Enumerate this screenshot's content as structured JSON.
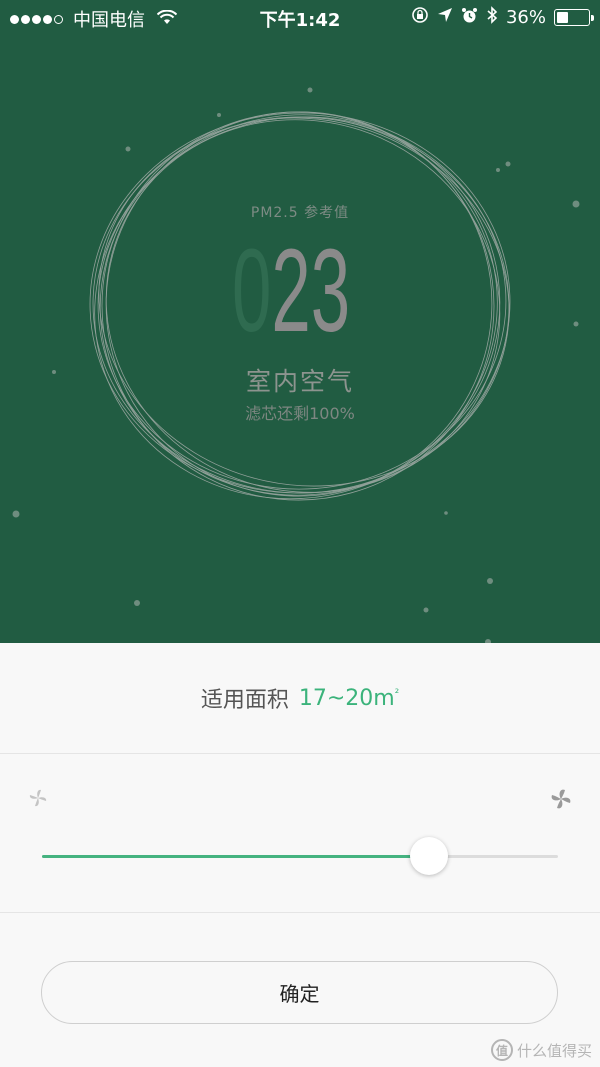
{
  "status_bar": {
    "carrier": "中国电信",
    "time": "下午1:42",
    "battery": "36%",
    "battery_level": 0.36,
    "icons": [
      "signal-dots",
      "wifi-icon",
      "orientation-lock-icon",
      "location-arrow-icon",
      "alarm-icon",
      "bluetooth-icon",
      "battery-icon"
    ]
  },
  "air": {
    "pm_label": "PM2.5 参考值",
    "pm_leading": "0",
    "pm_digits": "23",
    "room_title": "室内空气",
    "filter_text": "滤芯还剩100%"
  },
  "area": {
    "label": "适用面积",
    "value": "17~20m",
    "unit_sup": "²"
  },
  "speed": {
    "slider_level": 0.75,
    "slow_icon": "fan-slow-icon",
    "fast_icon": "fan-fast-icon"
  },
  "confirm_label": "确定",
  "watermark": {
    "logo": "值",
    "text": "什么值得买"
  },
  "colors": {
    "header_bg": "#215c42",
    "accent": "#3bb37b",
    "slider_fill": "#45b380"
  }
}
